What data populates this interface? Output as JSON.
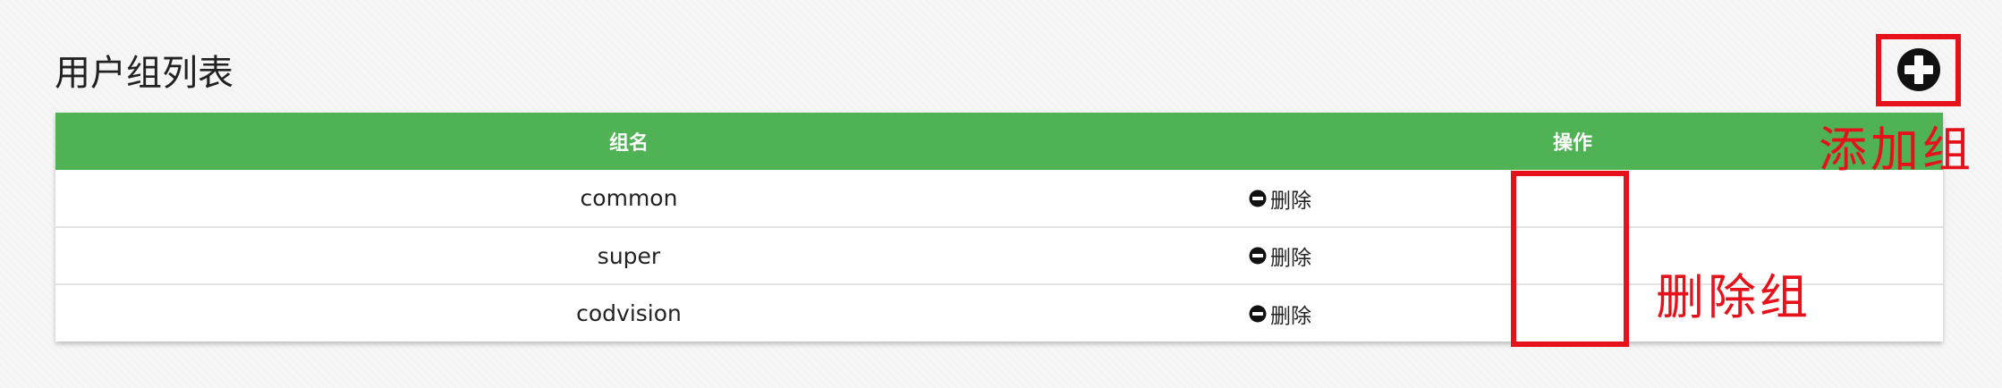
{
  "page": {
    "title": "用户组列表",
    "add_button_icon": "plus-circle-icon"
  },
  "table": {
    "headers": {
      "name": "组名",
      "actions": "操作"
    },
    "rows": [
      {
        "name": "common",
        "action_label": "删除",
        "action_icon": "minus-circle-icon"
      },
      {
        "name": "super",
        "action_label": "删除",
        "action_icon": "minus-circle-icon"
      },
      {
        "name": "codvision",
        "action_label": "删除",
        "action_icon": "minus-circle-icon"
      }
    ]
  },
  "annotations": {
    "add_group": "添加组",
    "delete_group": "删除组",
    "color": "#e5121c"
  },
  "colors": {
    "header_bg": "#4fb254",
    "header_text": "#ffffff",
    "page_bg": "#f6f6f6"
  }
}
